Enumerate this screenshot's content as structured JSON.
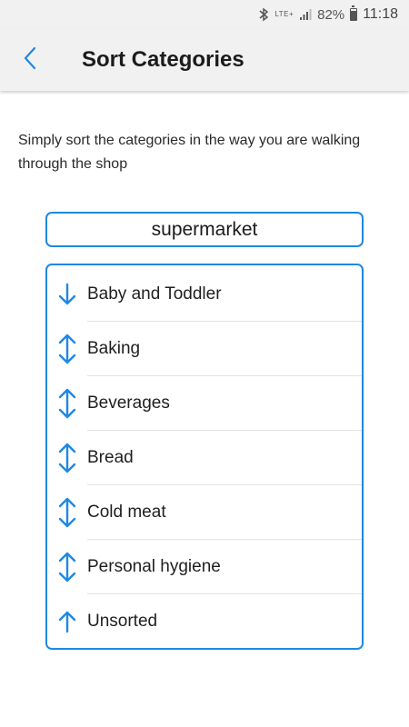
{
  "status_bar": {
    "battery": "82%",
    "time": "11:18",
    "network": "LTE+",
    "icons": [
      "bluetooth-icon",
      "signal-icon",
      "battery-icon"
    ]
  },
  "header": {
    "title": "Sort Categories",
    "back_icon": "back-arrow-icon"
  },
  "description": "Simply sort the categories in the way you are walking through the shop",
  "store": {
    "name": "supermarket"
  },
  "categories": [
    {
      "label": "Baby and Toddler",
      "arrow": "down"
    },
    {
      "label": "Baking",
      "arrow": "updown"
    },
    {
      "label": "Beverages",
      "arrow": "updown"
    },
    {
      "label": "Bread",
      "arrow": "updown"
    },
    {
      "label": "Cold meat",
      "arrow": "updown"
    },
    {
      "label": "Personal hygiene",
      "arrow": "updown"
    },
    {
      "label": "Unsorted",
      "arrow": "up"
    }
  ],
  "colors": {
    "accent": "#1e88e5",
    "appbar_bg": "#f1f1f1"
  }
}
